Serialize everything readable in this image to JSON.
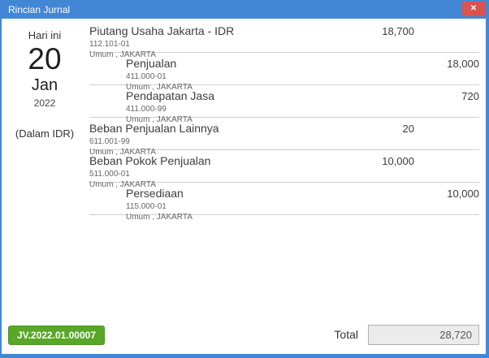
{
  "window": {
    "title": "Rincian Jurnal",
    "close_glyph": "✕"
  },
  "sidebar": {
    "today_label": "Hari ini",
    "day": "20",
    "month": "Jan",
    "year": "2022",
    "currency_note": "(Dalam IDR)"
  },
  "entries": [
    {
      "name": "Piutang Usaha Jakarta - IDR",
      "code": "112.101-01",
      "branch": "Umum , JAKARTA",
      "amount": "18,700",
      "side": "debit"
    },
    {
      "name": "Penjualan",
      "code": "411.000-01",
      "branch": "Umum , JAKARTA",
      "amount": "18,000",
      "side": "credit"
    },
    {
      "name": "Pendapatan Jasa",
      "code": "411.000-99",
      "branch": "Umum , JAKARTA",
      "amount": "720",
      "side": "credit"
    },
    {
      "name": "Beban Penjualan Lainnya",
      "code": "611.001-99",
      "branch": "Umum , JAKARTA",
      "amount": "20",
      "side": "debit"
    },
    {
      "name": "Beban Pokok Penjualan",
      "code": "511.000-01",
      "branch": "Umum , JAKARTA",
      "amount": "10,000",
      "side": "debit"
    },
    {
      "name": "Persediaan",
      "code": "115.000-01",
      "branch": "Umum , JAKARTA",
      "amount": "10,000",
      "side": "credit"
    }
  ],
  "footer": {
    "journal_number": "JV.2022.01.00007",
    "total_label": "Total",
    "total_value": "28,720"
  },
  "colors": {
    "accent_blue": "#4287d6",
    "close_red": "#d9534f",
    "badge_green": "#58a728",
    "separator_gray": "#cfcfcf"
  }
}
